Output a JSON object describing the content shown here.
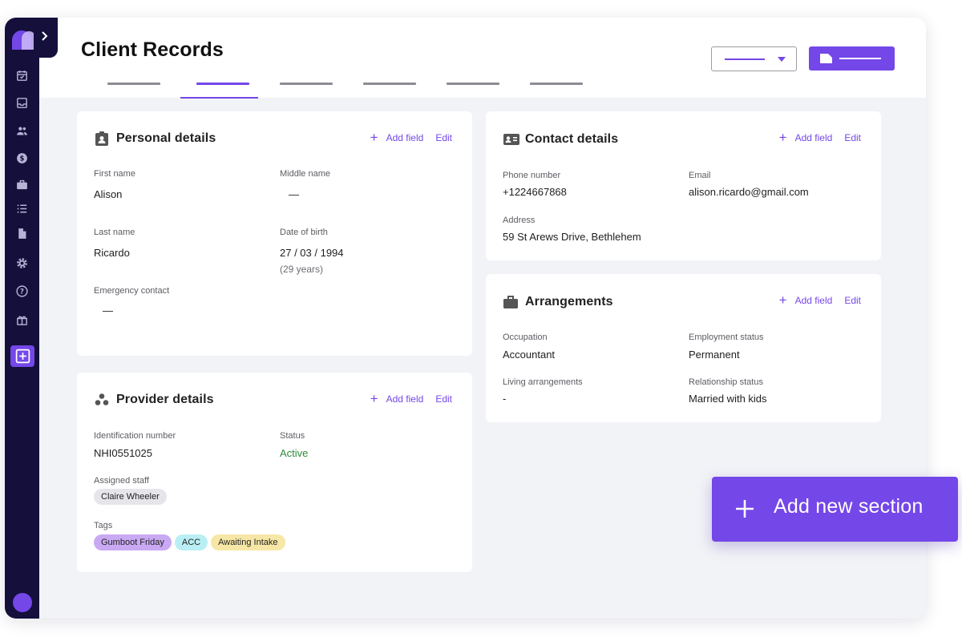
{
  "page": {
    "title": "Client Records",
    "accent": "#7447e8",
    "sidebar_bg": "#14103b"
  },
  "sidebar": {
    "icons": [
      "calendar-check-icon",
      "inbox-icon",
      "people-icon",
      "dollar-icon",
      "briefcase-icon",
      "list-icon",
      "document-icon",
      "settings-icon",
      "help-icon",
      "gift-icon",
      "add-box-icon"
    ]
  },
  "tabs_count": 6,
  "personal": {
    "title": "Personal details",
    "add_field": "Add field",
    "edit": "Edit",
    "first_name_label": "First name",
    "first_name": "Alison",
    "middle_name_label": "Middle name",
    "middle_name": "—",
    "last_name_label": "Last name",
    "last_name": "Ricardo",
    "dob_label": "Date of birth",
    "dob": "27 / 03 / 1994",
    "age": "(29 years)",
    "emergency_label": "Emergency contact",
    "emergency": "—"
  },
  "provider": {
    "title": "Provider details",
    "add_field": "Add field",
    "edit": "Edit",
    "id_label": "Identification number",
    "id_value": "NHI0551025",
    "status_label": "Status",
    "status_value": "Active",
    "staff_label": "Assigned staff",
    "staff_value": "Claire Wheeler",
    "tags_label": "Tags",
    "tags": [
      {
        "label": "Gumboot  Friday",
        "color": "#c9a9f3"
      },
      {
        "label": "ACC",
        "color": "#b9eff4"
      },
      {
        "label": "Awaiting Intake",
        "color": "#f7e7a6"
      }
    ]
  },
  "contact": {
    "title": "Contact details",
    "add_field": "Add field",
    "edit": "Edit",
    "phone_label": "Phone number",
    "phone": "+1224667868",
    "email_label": "Email",
    "email": "alison.ricardo@gmail.com",
    "address_label": "Address",
    "address": "59 St Arews Drive, Bethlehem"
  },
  "arrangements": {
    "title": "Arrangements",
    "add_field": "Add field",
    "edit": "Edit",
    "occupation_label": "Occupation",
    "occupation": "Accountant",
    "employment_label": "Employment status",
    "employment": "Permanent",
    "living_label": "Living arrangements",
    "living": "-",
    "relationship_label": "Relationship status",
    "relationship": "Married with kids"
  },
  "cta": {
    "label": "Add new section"
  }
}
